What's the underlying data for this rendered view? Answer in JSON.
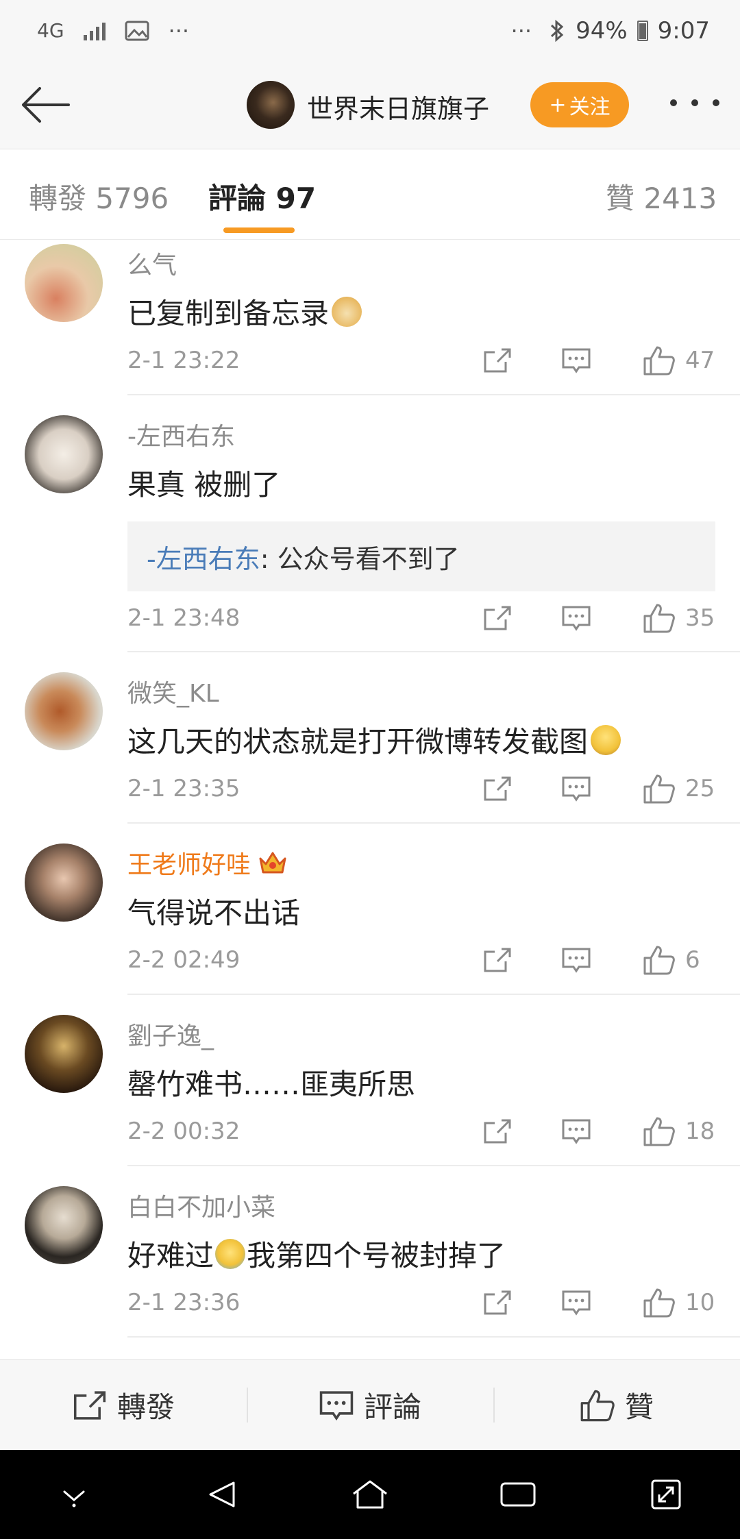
{
  "status_bar": {
    "network": "4G",
    "more": "···",
    "more_right": "···",
    "battery": "94%",
    "time": "9:07"
  },
  "nav": {
    "title": "世界末日旗旗子",
    "follow_label": "关注",
    "follow_plus": "+"
  },
  "tabs": {
    "repost": "轉發 5796",
    "comments": "評論 97",
    "likes": "贊 2413"
  },
  "comments": [
    {
      "name": "么气",
      "text": "已复制到备忘录",
      "emoji": "doge-emoji",
      "time": "2-1 23:22",
      "likes": "47"
    },
    {
      "name": "-左西右东",
      "text": "果真 被删了",
      "reply_name": "-左西右东",
      "reply_text": ": 公众号看不到了",
      "time": "2-1 23:48",
      "likes": "35"
    },
    {
      "name": "微笑_KL",
      "text": "这几天的状态就是打开微博转发截图",
      "emoji": "sigh-emoji",
      "time": "2-1 23:35",
      "likes": "25"
    },
    {
      "name": "王老师好哇",
      "text": "气得说不出话",
      "time": "2-2 02:49",
      "likes": "6",
      "vip": true
    },
    {
      "name": "劉子逸_",
      "text": "罄竹难书……匪夷所思",
      "time": "2-2 00:32",
      "likes": "18"
    },
    {
      "name": "白白不加小菜",
      "text_before": "好难过",
      "text_after": "我第四个号被封掉了",
      "emoji": "crying-emoji",
      "time": "2-1 23:36",
      "likes": "10"
    }
  ],
  "bottom_bar": {
    "repost": "轉發",
    "comment": "評論",
    "like": "贊"
  },
  "colors": {
    "accent": "#f79a23",
    "vip_name": "#ef7a1a",
    "reply_link": "#4a7cb8"
  }
}
